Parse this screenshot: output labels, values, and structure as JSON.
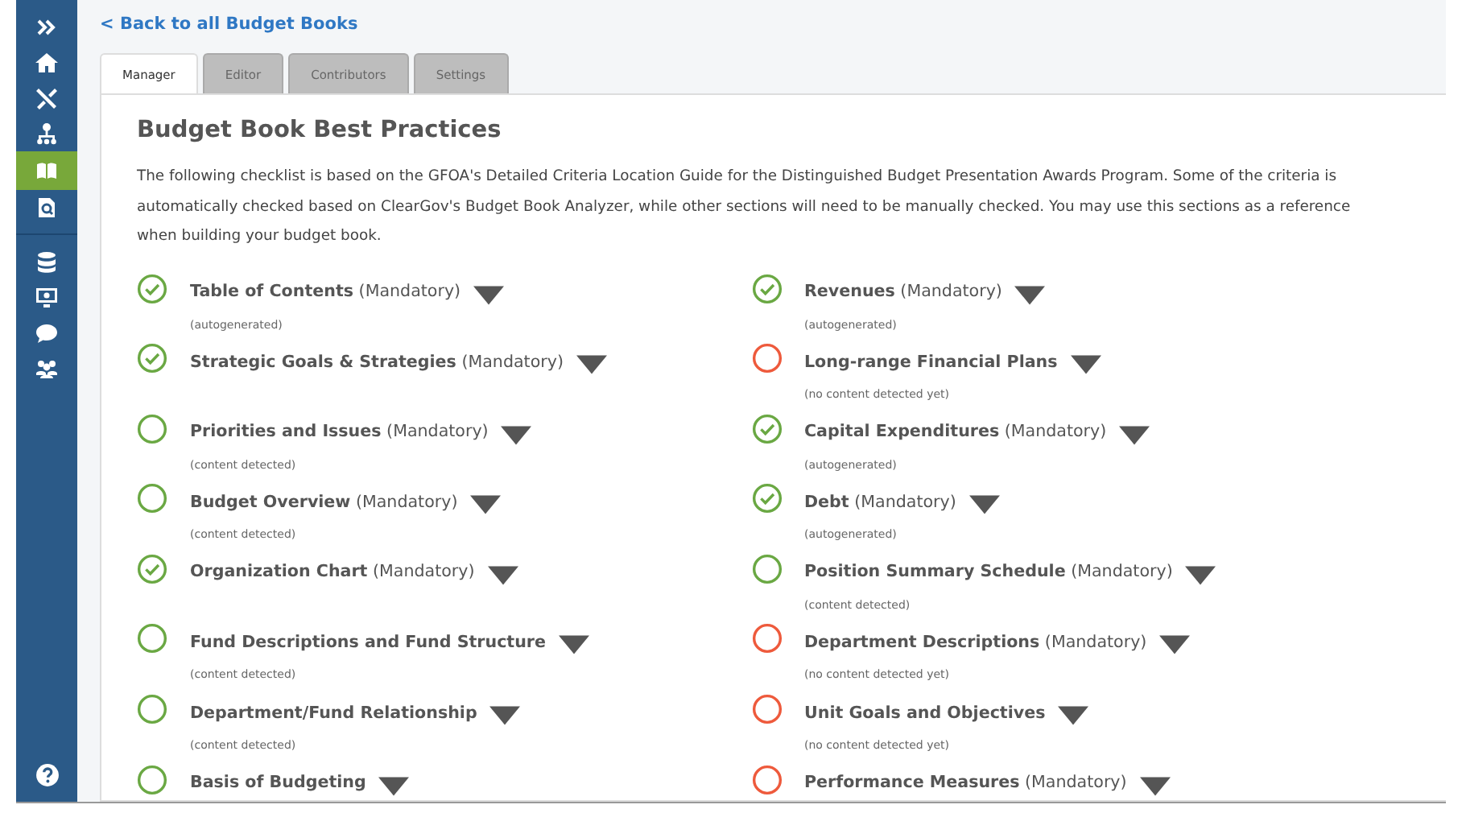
{
  "sidebar": {
    "items": [
      {
        "selected": false
      },
      {
        "selected": false
      },
      {
        "selected": false
      },
      {
        "selected": false
      },
      {
        "selected": true
      },
      {
        "selected": false
      },
      {
        "selected": false
      },
      {
        "selected": false
      },
      {
        "selected": false
      },
      {
        "selected": false
      }
    ]
  },
  "back_link": "< Back to all Budget Books",
  "tabs": [
    {
      "label": "Manager",
      "selected": true
    },
    {
      "label": "Editor",
      "selected": false
    },
    {
      "label": "Contributors",
      "selected": false
    },
    {
      "label": "Settings",
      "selected": false
    }
  ],
  "heading": "Budget Book Best Practices",
  "intro": "The following checklist is based on the GFOA's Detailed Criteria Location Guide for the Distinguished Budget Presentation Awards Program. Some of the criteria is automatically checked based on ClearGov's Budget Book Analyzer, while other sections will need to be manually checked. You may use this sections as a reference when building your budget book.",
  "columns": [
    {
      "items": [
        {
          "title": "Table of Contents",
          "qualifier": "(Mandatory)",
          "kind": "done",
          "note": "(autogenerated)"
        },
        {
          "title": "Strategic Goals & Strategies",
          "qualifier": "(Mandatory)",
          "kind": "done"
        },
        {
          "title": "Priorities and Issues",
          "qualifier": "(Mandatory)",
          "kind": "detected",
          "note": "(content detected)"
        },
        {
          "title": "Budget Overview",
          "qualifier": "(Mandatory)",
          "kind": "detected",
          "note": "(content detected)"
        },
        {
          "title": "Organization Chart",
          "qualifier": "(Mandatory)",
          "kind": "done"
        },
        {
          "title": "Fund Descriptions and Fund Structure",
          "kind": "detected",
          "note": "(content detected)"
        },
        {
          "title": "Department/Fund Relationship",
          "kind": "detected",
          "note": "(content detected)"
        },
        {
          "title": "Basis of Budgeting",
          "kind": "detected"
        }
      ]
    },
    {
      "items": [
        {
          "title": "Revenues",
          "qualifier": "(Mandatory)",
          "kind": "done",
          "note": "(autogenerated)"
        },
        {
          "title": "Long-range Financial Plans",
          "kind": "missing",
          "note": "(no content detected yet)"
        },
        {
          "title": "Capital Expenditures",
          "qualifier": "(Mandatory)",
          "kind": "done",
          "note": "(autogenerated)"
        },
        {
          "title": "Debt",
          "qualifier": "(Mandatory)",
          "kind": "done",
          "note": "(autogenerated)"
        },
        {
          "title": "Position Summary Schedule",
          "qualifier": "(Mandatory)",
          "kind": "detected",
          "note": "(content detected)"
        },
        {
          "title": "Department Descriptions",
          "qualifier": "(Mandatory)",
          "kind": "missing",
          "note": "(no content detected yet)"
        },
        {
          "title": "Unit Goals and Objectives",
          "kind": "missing",
          "note": "(no content detected yet)"
        },
        {
          "title": "Performance Measures",
          "qualifier": "(Mandatory)",
          "kind": "missing"
        }
      ]
    }
  ]
}
